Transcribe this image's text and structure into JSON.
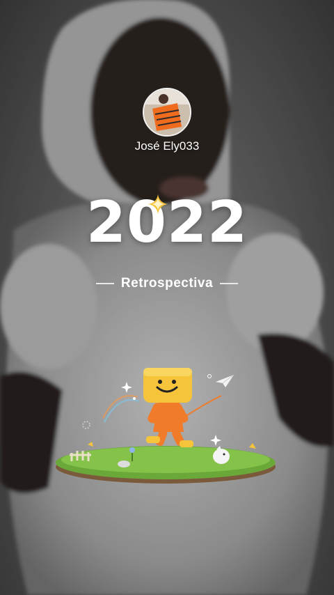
{
  "user": {
    "name": "José Ely033"
  },
  "hero": {
    "year": "2022",
    "subtitle": "Retrospectiva"
  },
  "icons": {
    "avatar": "profile-photo",
    "sparkle": "sparkle-icon",
    "mascot": "mascot-illustration"
  },
  "colors": {
    "accent_yellow": "#f5c43b",
    "mascot_orange": "#f07c2a",
    "grass_green": "#6aa83a"
  }
}
